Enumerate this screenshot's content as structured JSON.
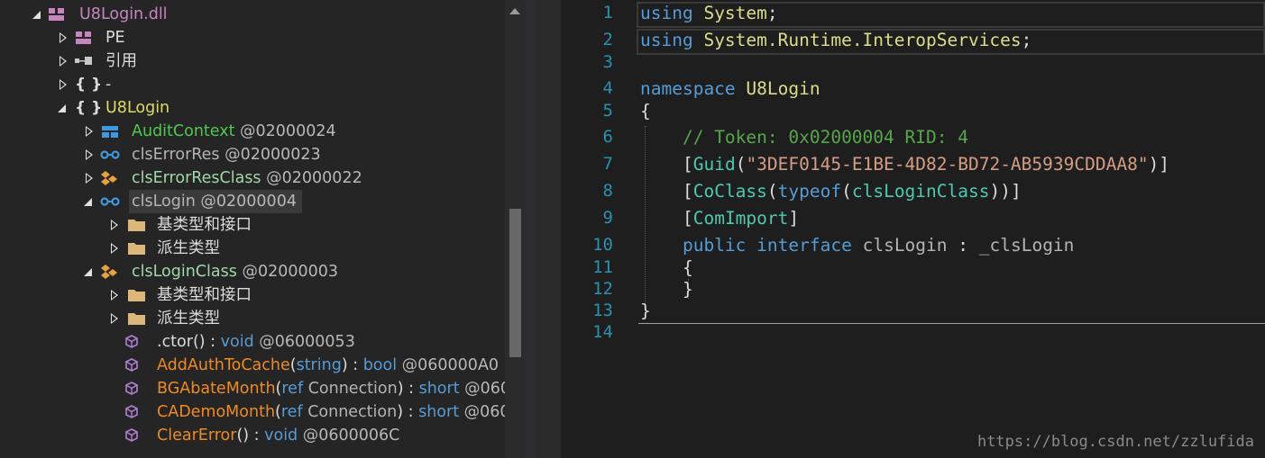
{
  "tree": {
    "root": {
      "label": "U8Login.dll"
    },
    "pe": {
      "label": "PE"
    },
    "refs": {
      "label": "引用"
    },
    "dash_ns": {
      "label": "-"
    },
    "ns": {
      "label": "U8Login"
    },
    "types": [
      {
        "name": "AuditContext",
        "token": "@02000024"
      },
      {
        "name": "clsErrorRes",
        "token": "@02000023"
      },
      {
        "name": "clsErrorResClass",
        "token": "@02000022"
      },
      {
        "name": "clsLogin",
        "token": "@02000004"
      },
      {
        "name": "clsLoginClass",
        "token": "@02000003"
      }
    ],
    "base_types": "基类型和接口",
    "derived_types": "派生类型",
    "methods": [
      {
        "name": ".ctor",
        "open": "(",
        "params": "",
        "ref": "",
        "close": ")",
        "sep": " : ",
        "ret": "void",
        "token": " @06000053"
      },
      {
        "name": "AddAuthToCache",
        "open": "(",
        "params": "string",
        "ref": "",
        "close": ")",
        "sep": " : ",
        "ret": "bool",
        "token": " @060000A0"
      },
      {
        "name": "BGAbateMonth",
        "open": "(",
        "params": "Connection",
        "ref": "ref ",
        "close": ")",
        "sep": " : ",
        "ret": "short",
        "token": " @060"
      },
      {
        "name": "CADemoMonth",
        "open": "(",
        "params": "Connection",
        "ref": "ref ",
        "close": ")",
        "sep": " : ",
        "ret": "short",
        "token": " @060"
      },
      {
        "name": "ClearError",
        "open": "(",
        "params": "",
        "ref": "",
        "close": ")",
        "sep": " : ",
        "ret": "void",
        "token": " @0600006C"
      }
    ]
  },
  "code": {
    "line_numbers": [
      "1",
      "2",
      "3",
      "4",
      "5",
      "6",
      "7",
      "8",
      "9",
      "10",
      "11",
      "12",
      "13",
      "14"
    ],
    "l1_kw": "using",
    "l1_ns": "System",
    "l1_end": ";",
    "l2_kw": "using",
    "l2_ns": "System.Runtime.InteropServices",
    "l2_end": ";",
    "l4_kw": "namespace",
    "l4_ns": "U8Login",
    "brace_open": "{",
    "brace_close": "}",
    "l6_comment": "// Token: 0x02000004 RID: 4",
    "l7_open": "[",
    "l7_attr": "Guid",
    "l7_paren": "(",
    "l7_str": "\"3DEF0145-E1BE-4D82-BD72-AB5939CDDAA8\"",
    "l7_close": ")]",
    "l8_open": "[",
    "l8_attr": "CoClass",
    "l8_paren": "(",
    "l8_kw": "typeof",
    "l8_paren2": "(",
    "l8_type": "clsLoginClass",
    "l8_close": "))]",
    "l9_open": "[",
    "l9_attr": "ComImport",
    "l9_close": "]",
    "l10_kw1": "public",
    "l10_kw2": "interface",
    "l10_name": "clsLogin",
    "l10_colon": " : ",
    "l10_base": "_clsLogin"
  },
  "watermark": "https://blog.csdn.net/zzlufida",
  "colors": {
    "line_number": "#2b91af",
    "keyword": "#569cd6",
    "comment": "#57a64a",
    "string": "#d69d85"
  }
}
